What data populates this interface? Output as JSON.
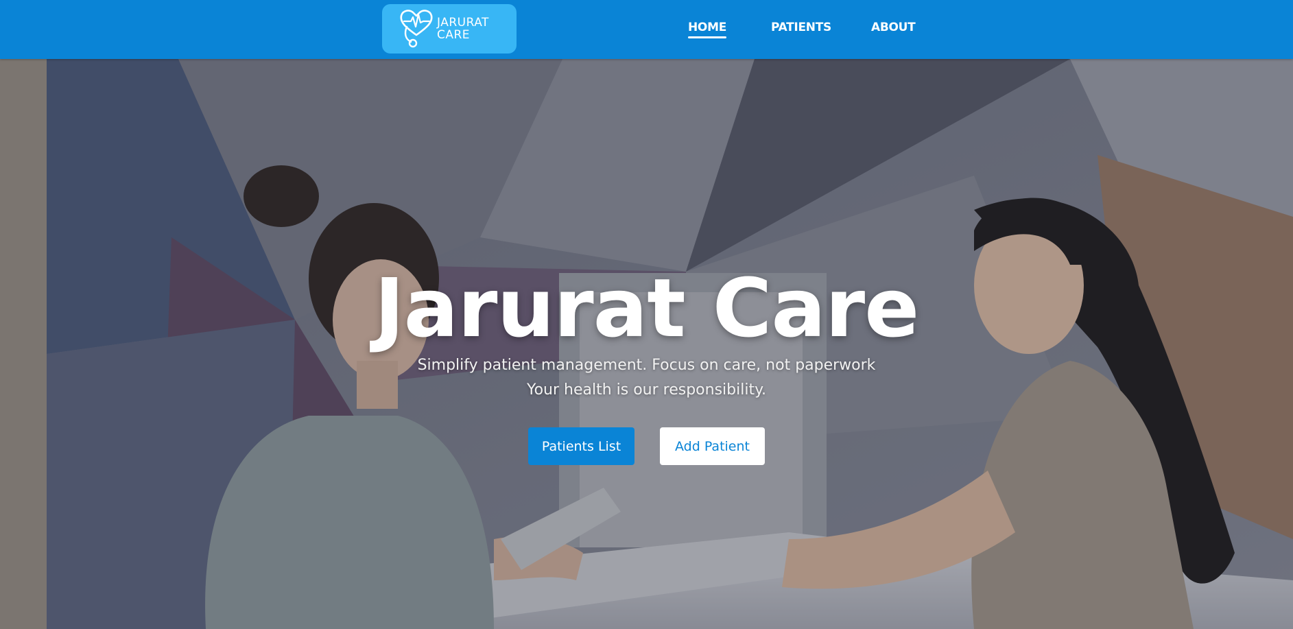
{
  "header": {
    "logo_text": "JARURAT\nCARE",
    "nav": [
      {
        "label": "HOME",
        "active": true
      },
      {
        "label": "PATIENTS",
        "active": false
      },
      {
        "label": "ABOUT",
        "active": false
      }
    ]
  },
  "hero": {
    "title": "Jarurat Care",
    "subtitle_line1": "Simplify patient management. Focus on care, not paperwork",
    "subtitle_line2": "Your health is our responsibility.",
    "primary_button": "Patients List",
    "secondary_button": "Add Patient"
  },
  "colors": {
    "header_bg": "#0a84d6",
    "logo_bg": "#38b6f5",
    "primary_button_bg": "#0a84d6",
    "secondary_button_bg": "#ffffff",
    "secondary_button_text": "#0a84d6"
  },
  "icons": {
    "logo": "heart-stethoscope-icon"
  }
}
